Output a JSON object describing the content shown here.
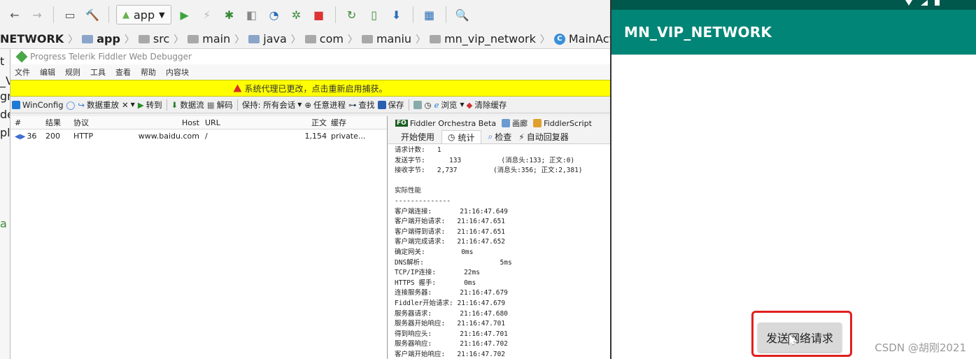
{
  "ide": {
    "run_config": "app",
    "breadcrumb": [
      "NETWORK",
      "app",
      "src",
      "main",
      "java",
      "com",
      "maniu",
      "mn_vip_network",
      "MainActivity"
    ],
    "left_fragments": [
      "t",
      "_V",
      "gra",
      "de",
      "pl",
      "a"
    ]
  },
  "fiddler": {
    "title": "Progress Telerik Fiddler Web Debugger",
    "menu": [
      "文件",
      "编辑",
      "规则",
      "工具",
      "查看",
      "帮助",
      "内容块"
    ],
    "warning": "系统代理已更改，点击重新启用捕获。",
    "toolbar": {
      "winconfig": "WinConfig",
      "replay": "数据重放",
      "remove": "✕",
      "goto": "转到",
      "stream": "数据流",
      "decode": "解码",
      "keep": "保持: 所有会话",
      "any_process": "任意进程",
      "find": "查找",
      "save": "保存",
      "browse": "浏览",
      "clear_cache": "清除缓存"
    },
    "sessions": {
      "columns": [
        "#",
        "结果",
        "协议",
        "Host",
        "URL",
        "正文",
        "缓存"
      ],
      "rows": [
        {
          "num": "36",
          "result": "200",
          "protocol": "HTTP",
          "host": "www.baidu.com",
          "url": "/",
          "body": "1,154",
          "cache": "private..."
        }
      ]
    },
    "inspector": {
      "tabs_top": [
        "Fiddler Orchestra Beta",
        "画廊",
        "FiddlerScript"
      ],
      "fo_badge": "FO",
      "tabs_bottom": [
        "开始使用",
        "统计",
        "检查",
        "自动回复器"
      ],
      "stats_lines": [
        "请求计数:   1",
        "发送字节:      133          (消息头:133; 正文:0)",
        "接收字节:   2,737         (消息头:356; 正文:2,381)",
        "",
        "实际性能",
        "--------------",
        "客户端连接:       21:16:47.649",
        "客户端开始请求:   21:16:47.651",
        "客户端得到请求:   21:16:47.651",
        "客户端完成请求:   21:16:47.652",
        "确定网关:         0ms",
        "DNS解析:                   5ms",
        "TCP/IP连接:       22ms",
        "HTTPS 握手:       0ms",
        "连接服务器:       21:16:47.679",
        "Fiddler开始请求: 21:16:47.679",
        "服务器请求:       21:16:47.680",
        "服务器开始响应:   21:16:47.701",
        "得到响应头:       21:16:47.701",
        "服务器响应:       21:16:47.702",
        "客户端开始响应:   21:16:47.702"
      ]
    }
  },
  "android": {
    "app_title": "MN_VIP_NETWORK",
    "send_button": "发送网络请求",
    "watermark": "CSDN @胡刚2021",
    "colors": {
      "app_bar": "#008577",
      "status_bar": "#00574b",
      "highlight": "#e02020"
    }
  }
}
